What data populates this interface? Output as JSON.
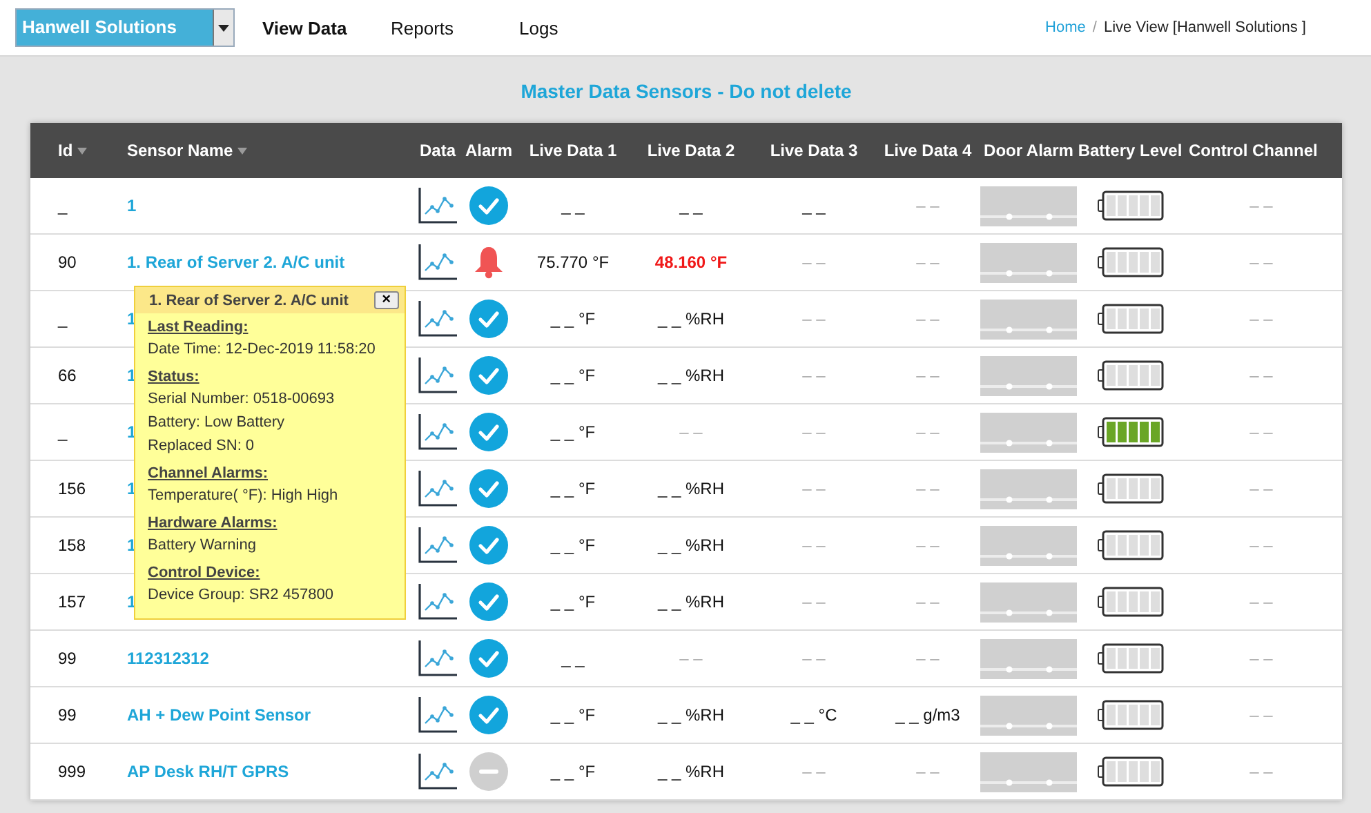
{
  "company_select": {
    "value": "Hanwell Solutions"
  },
  "nav": [
    {
      "label": "View Data",
      "selected": true
    },
    {
      "label": "Reports",
      "selected": false
    },
    {
      "label": "Logs",
      "selected": false
    }
  ],
  "breadcrumb": {
    "home": "Home",
    "separator": "/",
    "current": "Live View [Hanwell Solutions ]"
  },
  "title": "Master Data Sensors - Do not delete",
  "table": {
    "columns": [
      {
        "label": "Id",
        "sortable": true
      },
      {
        "label": "Sensor Name",
        "sortable": true
      },
      {
        "label": "Data",
        "sortable": false
      },
      {
        "label": "Alarm",
        "sortable": false
      },
      {
        "label": "Live Data 1",
        "sortable": false
      },
      {
        "label": "Live Data 2",
        "sortable": false
      },
      {
        "label": "Live Data 3",
        "sortable": false
      },
      {
        "label": "Live Data 4",
        "sortable": false
      },
      {
        "label": "Door Alarm",
        "sortable": false
      },
      {
        "label": "Battery Level",
        "sortable": false
      },
      {
        "label": "Control Channel",
        "sortable": false
      }
    ],
    "rows": [
      {
        "id": "_",
        "name": "1",
        "alarm": {
          "kind": "ok"
        },
        "live": [
          {
            "text": "_ _",
            "kind": "value"
          },
          {
            "text": "_ _",
            "kind": "value"
          },
          {
            "text": "_ _",
            "kind": "value"
          },
          {
            "text": "– –",
            "kind": "empty"
          }
        ],
        "battery": {
          "charged": false
        },
        "control": "– –"
      },
      {
        "id": "90",
        "name": "1. Rear of Server 2. A/C unit",
        "alarm": {
          "kind": "alarm"
        },
        "live": [
          {
            "text": "75.770 °F",
            "kind": "value"
          },
          {
            "text": "48.160 °F",
            "kind": "alert"
          },
          {
            "text": "– –",
            "kind": "empty"
          },
          {
            "text": "– –",
            "kind": "empty"
          }
        ],
        "battery": {
          "charged": false
        },
        "control": "– –"
      },
      {
        "id": "_",
        "name": "1",
        "alarm": {
          "kind": "ok"
        },
        "live": [
          {
            "text": "_ _ °F",
            "kind": "value"
          },
          {
            "text": "_ _ %RH",
            "kind": "value"
          },
          {
            "text": "– –",
            "kind": "empty"
          },
          {
            "text": "– –",
            "kind": "empty"
          }
        ],
        "battery": {
          "charged": false
        },
        "control": "– –"
      },
      {
        "id": "66",
        "name": "1",
        "alarm": {
          "kind": "ok"
        },
        "live": [
          {
            "text": "_ _ °F",
            "kind": "value"
          },
          {
            "text": "_ _ %RH",
            "kind": "value"
          },
          {
            "text": "– –",
            "kind": "empty"
          },
          {
            "text": "– –",
            "kind": "empty"
          }
        ],
        "battery": {
          "charged": false
        },
        "control": "– –"
      },
      {
        "id": "_",
        "name": "1",
        "alarm": {
          "kind": "ok"
        },
        "live": [
          {
            "text": "_ _ °F",
            "kind": "value"
          },
          {
            "text": "– –",
            "kind": "empty"
          },
          {
            "text": "– –",
            "kind": "empty"
          },
          {
            "text": "– –",
            "kind": "empty"
          }
        ],
        "battery": {
          "charged": true
        },
        "control": "– –"
      },
      {
        "id": "156",
        "name": "1",
        "alarm": {
          "kind": "ok"
        },
        "live": [
          {
            "text": "_ _ °F",
            "kind": "value"
          },
          {
            "text": "_ _ %RH",
            "kind": "value"
          },
          {
            "text": "– –",
            "kind": "empty"
          },
          {
            "text": "– –",
            "kind": "empty"
          }
        ],
        "battery": {
          "charged": false
        },
        "control": "– –"
      },
      {
        "id": "158",
        "name": "1",
        "alarm": {
          "kind": "ok"
        },
        "live": [
          {
            "text": "_ _ °F",
            "kind": "value"
          },
          {
            "text": "_ _ %RH",
            "kind": "value"
          },
          {
            "text": "– –",
            "kind": "empty"
          },
          {
            "text": "– –",
            "kind": "empty"
          }
        ],
        "battery": {
          "charged": false
        },
        "control": "– –"
      },
      {
        "id": "157",
        "name": "1",
        "alarm": {
          "kind": "ok"
        },
        "live": [
          {
            "text": "_ _ °F",
            "kind": "value"
          },
          {
            "text": "_ _ %RH",
            "kind": "value"
          },
          {
            "text": "– –",
            "kind": "empty"
          },
          {
            "text": "– –",
            "kind": "empty"
          }
        ],
        "battery": {
          "charged": false
        },
        "control": "– –"
      },
      {
        "id": "99",
        "name": "112312312",
        "alarm": {
          "kind": "ok"
        },
        "live": [
          {
            "text": "_ _",
            "kind": "value"
          },
          {
            "text": "– –",
            "kind": "empty"
          },
          {
            "text": "– –",
            "kind": "empty"
          },
          {
            "text": "– –",
            "kind": "empty"
          }
        ],
        "battery": {
          "charged": false
        },
        "control": "– –"
      },
      {
        "id": "99",
        "name": "AH + Dew Point Sensor",
        "alarm": {
          "kind": "ok"
        },
        "live": [
          {
            "text": "_ _ °F",
            "kind": "value"
          },
          {
            "text": "_ _ %RH",
            "kind": "value"
          },
          {
            "text": "_ _ °C",
            "kind": "value"
          },
          {
            "text": "_ _ g/m3",
            "kind": "value"
          }
        ],
        "battery": {
          "charged": false
        },
        "control": "– –"
      },
      {
        "id": "999",
        "name": "AP Desk RH/T GPRS",
        "alarm": {
          "kind": "disabled"
        },
        "live": [
          {
            "text": "_ _ °F",
            "kind": "value"
          },
          {
            "text": "_ _ %RH",
            "kind": "value"
          },
          {
            "text": "– –",
            "kind": "empty"
          },
          {
            "text": "– –",
            "kind": "empty"
          }
        ],
        "battery": {
          "charged": false
        },
        "control": "– –"
      }
    ]
  },
  "popup": {
    "title": "1. Rear of Server 2. A/C unit",
    "close": "×",
    "sections": [
      {
        "heading": "Last Reading:",
        "lines": [
          "Date Time: 12-Dec-2019 11:58:20"
        ]
      },
      {
        "heading": "Status:",
        "lines": [
          "Serial Number: 0518-00693",
          "Battery: Low Battery",
          "Replaced SN: 0"
        ]
      },
      {
        "heading": "Channel Alarms:",
        "lines": [
          "Temperature( °F): High High"
        ]
      },
      {
        "heading": "Hardware Alarms:",
        "lines": [
          "Battery Warning"
        ]
      },
      {
        "heading": "Control Device:",
        "lines": [
          "Device Group: SR2 457800"
        ]
      }
    ]
  }
}
